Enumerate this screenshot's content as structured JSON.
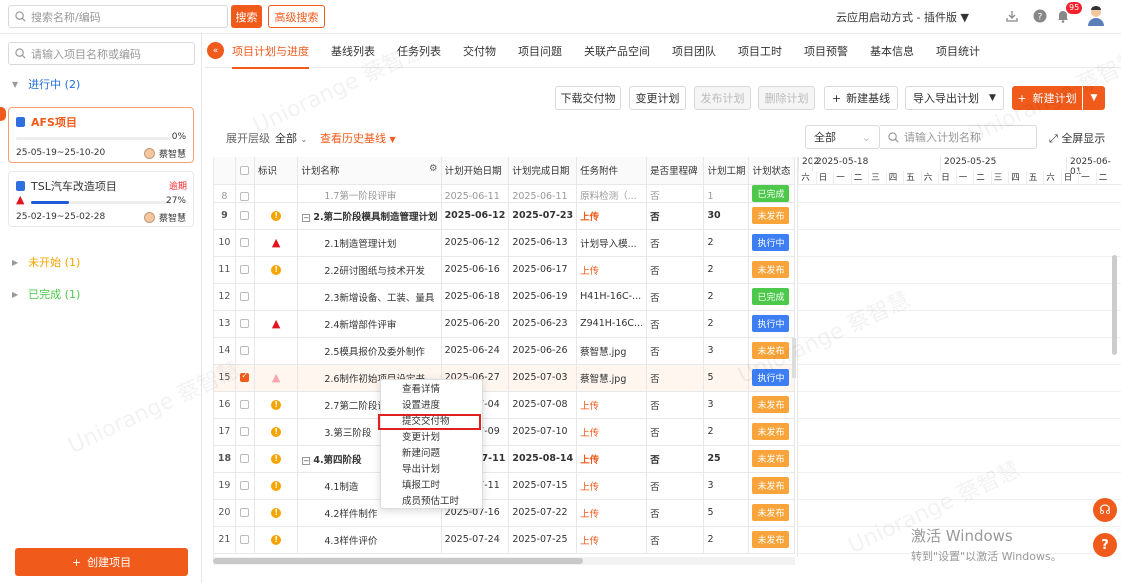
{
  "topbar": {
    "search_placeholder": "搜索名称/编码",
    "search_btn": "搜索",
    "advanced_btn": "高级搜索",
    "startup_mode": "云应用启动方式 - 插件版",
    "notif_count": "95"
  },
  "sidebar": {
    "search_placeholder": "请输入项目名称或编码",
    "group_inprogress": "进行中 (2)",
    "group_notstarted": "未开始 (1)",
    "group_done": "已完成 (1)",
    "create_btn": "创建项目",
    "projects": [
      {
        "name": "AFS项目",
        "progress": "0%",
        "progress_value": 0,
        "dates": "25-05-19~25-10-20",
        "owner": "蔡智慧"
      },
      {
        "name": "TSL汽车改造项目",
        "status": "逾期",
        "progress": "27%",
        "progress_value": 27,
        "dates": "25-02-19~25-02-28",
        "owner": "蔡智慧"
      }
    ]
  },
  "tabs": [
    "项目计划与进度",
    "基线列表",
    "任务列表",
    "交付物",
    "项目问题",
    "关联产品空间",
    "项目团队",
    "项目工时",
    "项目预警",
    "基本信息",
    "项目统计"
  ],
  "actions": {
    "download": "下载交付物",
    "change": "变更计划",
    "publish": "发布计划",
    "delete": "删除计划",
    "new_baseline": "新建基线",
    "import_export": "导入导出计划",
    "new_plan": "新建计划"
  },
  "filter": {
    "expand_label": "展开层级",
    "expand_value": "全部",
    "history_baseline": "查看历史基线",
    "select_value": "全部",
    "plan_search_placeholder": "请输入计划名称",
    "fullscreen": "全屏显示"
  },
  "table": {
    "headers": [
      "",
      "标识",
      "计划名称",
      "计划开始日期",
      "计划完成日期",
      "任务附件",
      "是否里程碑",
      "计划工期",
      "计划状态"
    ],
    "rows": [
      {
        "num": "8",
        "flag": "",
        "name": "1.7第一阶段评审",
        "start": "2025-06-11",
        "end": "2025-06-11",
        "attach": "原料检测（...",
        "milestone": "否",
        "dur": "1",
        "status": "已完成",
        "color": "green",
        "partial": true
      },
      {
        "num": "9",
        "flag": "dot",
        "name": "2.第二阶段模具制造管理计划",
        "start": "2025-06-12",
        "end": "2025-07-23",
        "attach": "上传",
        "milestone": "否",
        "dur": "30",
        "status": "未发布",
        "color": "orange",
        "bold": true
      },
      {
        "num": "10",
        "flag": "tri",
        "name": "2.1制造管理计划",
        "start": "2025-06-12",
        "end": "2025-06-13",
        "attach": "计划导入模...",
        "milestone": "否",
        "dur": "2",
        "status": "执行中",
        "color": "blue"
      },
      {
        "num": "11",
        "flag": "dot",
        "name": "2.2研讨图纸与技术开发",
        "start": "2025-06-16",
        "end": "2025-06-17",
        "attach": "上传",
        "milestone": "否",
        "dur": "2",
        "status": "未发布",
        "color": "orange"
      },
      {
        "num": "12",
        "flag": "",
        "name": "2.3新增设备、工装、量具",
        "start": "2025-06-18",
        "end": "2025-06-19",
        "attach": "H41H-16C-...",
        "milestone": "否",
        "dur": "2",
        "status": "已完成",
        "color": "green"
      },
      {
        "num": "13",
        "flag": "tri",
        "name": "2.4新增部件评审",
        "start": "2025-06-20",
        "end": "2025-06-23",
        "attach": "Z941H-16C...",
        "milestone": "否",
        "dur": "2",
        "status": "执行中",
        "color": "blue"
      },
      {
        "num": "14",
        "flag": "",
        "name": "2.5模具报价及委外制作",
        "start": "2025-06-24",
        "end": "2025-06-26",
        "attach": "蔡智慧.jpg",
        "milestone": "否",
        "dur": "3",
        "status": "未发布",
        "color": "orange"
      },
      {
        "num": "15",
        "flag": "tri-light",
        "name": "2.6制作初始项目设定书",
        "start": "2025-06-27",
        "end": "2025-07-03",
        "attach": "蔡智慧.jpg",
        "milestone": "否",
        "dur": "5",
        "status": "执行中",
        "color": "blue",
        "selected": true
      },
      {
        "num": "16",
        "flag": "dot",
        "name": "2.7第二阶段评审",
        "start": "2025-07-04",
        "end": "2025-07-08",
        "attach": "上传",
        "milestone": "否",
        "dur": "3",
        "status": "未发布",
        "color": "orange"
      },
      {
        "num": "17",
        "flag": "dot",
        "name": "3.第三阶段",
        "start": "2025-07-09",
        "end": "2025-07-10",
        "attach": "上传",
        "milestone": "否",
        "dur": "2",
        "status": "未发布",
        "color": "orange"
      },
      {
        "num": "18",
        "flag": "dot",
        "name": "4.第四阶段",
        "start": "2025-07-11",
        "end": "2025-08-14",
        "attach": "上传",
        "milestone": "否",
        "dur": "25",
        "status": "未发布",
        "color": "orange",
        "bold": true
      },
      {
        "num": "19",
        "flag": "dot",
        "name": "4.1制造",
        "start": "2025-07-11",
        "end": "2025-07-15",
        "attach": "上传",
        "milestone": "否",
        "dur": "3",
        "status": "未发布",
        "color": "orange"
      },
      {
        "num": "20",
        "flag": "dot",
        "name": "4.2样件制作",
        "start": "2025-07-16",
        "end": "2025-07-22",
        "attach": "上传",
        "milestone": "否",
        "dur": "5",
        "status": "未发布",
        "color": "orange"
      },
      {
        "num": "21",
        "flag": "dot",
        "name": "4.3样件评价",
        "start": "2025-07-24",
        "end": "2025-07-25",
        "attach": "上传",
        "milestone": "否",
        "dur": "2",
        "status": "未发布",
        "color": "orange"
      }
    ]
  },
  "gantt": {
    "weeks": [
      "202",
      "2025-05-18",
      "2025-05-25",
      "2025-06-01"
    ],
    "days": [
      "六",
      "日",
      "一",
      "二",
      "三",
      "四",
      "五",
      "六",
      "日",
      "一",
      "二",
      "三",
      "四",
      "五",
      "六",
      "日",
      "一",
      "二"
    ]
  },
  "context_menu": [
    "查看详情",
    "设置进度",
    "提交交付物",
    "变更计划",
    "新建问题",
    "导出计划",
    "填报工时",
    "成员预估工时"
  ],
  "windows": {
    "line1": "激活 Windows",
    "line2": "转到\"设置\"以激活 Windows。"
  },
  "watermark": "Uniorange 蔡智慧"
}
